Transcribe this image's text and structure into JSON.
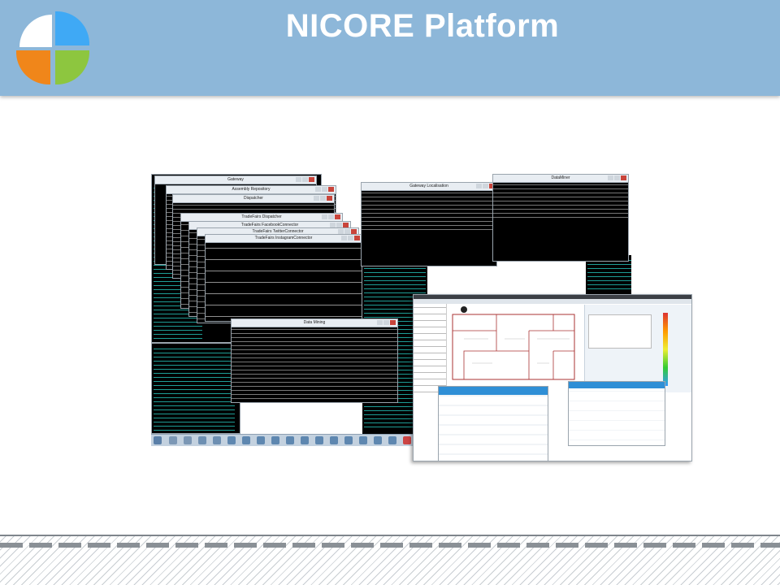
{
  "header": {
    "title": "NICORE Platform",
    "logo": {
      "colors": [
        "#f0861a",
        "#3fa9f5",
        "#8dc63f",
        "#f0861a"
      ]
    }
  },
  "screenshot": {
    "windows": [
      {
        "id": "gateway",
        "title": "Gateway"
      },
      {
        "id": "assembly",
        "title": "Assembly Repository"
      },
      {
        "id": "dispatcher",
        "title": "Dispatcher"
      },
      {
        "id": "tradefairs-dispatcher",
        "title": "TradeFairs Dispatcher"
      },
      {
        "id": "facebook",
        "title": "TradeFairs FacebookConnector"
      },
      {
        "id": "twitter",
        "title": "TradeFairs TwitterConnector"
      },
      {
        "id": "instagram",
        "title": "TradeFairs InstagramConnector"
      },
      {
        "id": "gateway-localisation",
        "title": "Gateway Localisation"
      },
      {
        "id": "dataminer",
        "title": "DataMiner"
      },
      {
        "id": "datamining",
        "title": "Data Mining"
      }
    ]
  }
}
